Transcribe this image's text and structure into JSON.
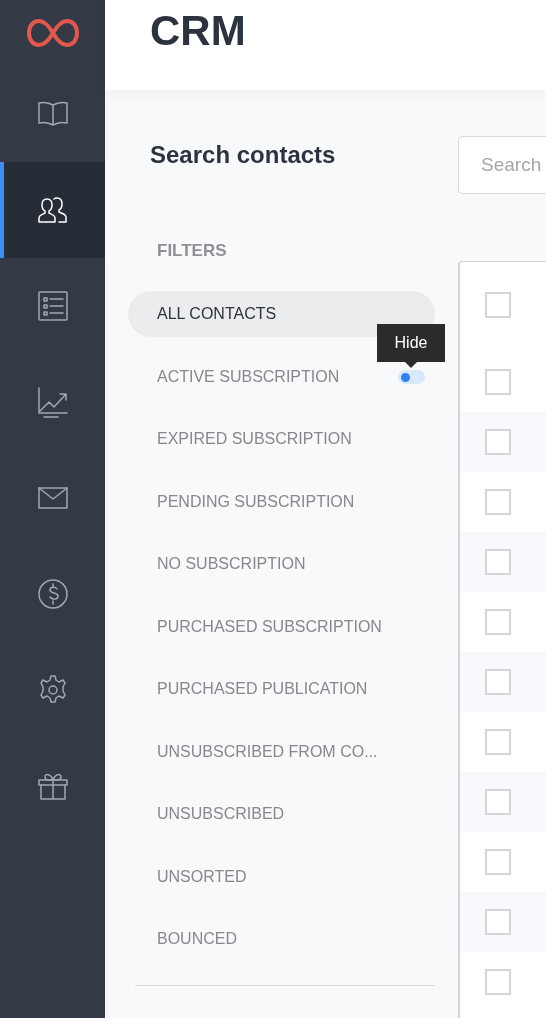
{
  "sidebar": {
    "items": [
      {
        "kind": "book",
        "selected": false
      },
      {
        "kind": "contacts",
        "selected": true
      },
      {
        "kind": "list",
        "selected": false
      },
      {
        "kind": "chart",
        "selected": false
      },
      {
        "kind": "mail",
        "selected": false
      },
      {
        "kind": "dollar",
        "selected": false
      },
      {
        "kind": "gear",
        "selected": false
      },
      {
        "kind": "gift",
        "selected": false
      }
    ]
  },
  "header": {
    "title": "CRM"
  },
  "search": {
    "heading": "Search contacts",
    "placeholder": "Search"
  },
  "filters": {
    "heading": "FILTERS",
    "items": [
      {
        "label": "ALL CONTACTS",
        "selected": true
      },
      {
        "label": "ACTIVE SUBSCRIPTION",
        "selected": false,
        "toggle": {
          "on": false,
          "tooltip": "Hide"
        }
      },
      {
        "label": "EXPIRED SUBSCRIPTION",
        "selected": false
      },
      {
        "label": "PENDING SUBSCRIPTION",
        "selected": false
      },
      {
        "label": "NO SUBSCRIPTION",
        "selected": false
      },
      {
        "label": "PURCHASED SUBSCRIPTION",
        "selected": false
      },
      {
        "label": "PURCHASED PUBLICATION",
        "selected": false
      },
      {
        "label": "UNSUBSCRIBED FROM CO...",
        "selected": false
      },
      {
        "label": "UNSUBSCRIBED",
        "selected": false
      },
      {
        "label": "UNSORTED",
        "selected": false
      },
      {
        "label": "BOUNCED",
        "selected": false
      }
    ]
  },
  "table": {
    "header_checked": false,
    "rows": [
      {
        "checked": false
      },
      {
        "checked": false
      },
      {
        "checked": false
      },
      {
        "checked": false
      },
      {
        "checked": false
      },
      {
        "checked": false
      },
      {
        "checked": false
      },
      {
        "checked": false
      },
      {
        "checked": false
      },
      {
        "checked": false
      },
      {
        "checked": false
      }
    ]
  }
}
